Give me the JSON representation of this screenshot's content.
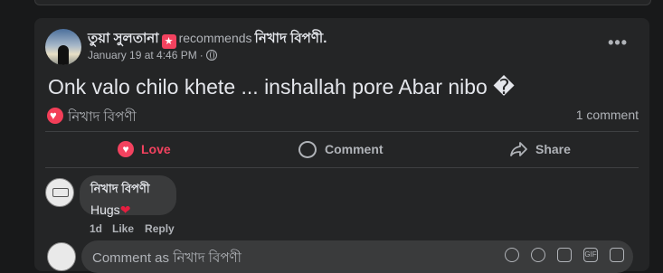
{
  "post": {
    "author": "তুয়া সুলতানা",
    "recommends_text": "recommends",
    "page_name": "নিখাদ বিপণী",
    "timestamp": "January 19 at 4:46 PM",
    "meta_separator": "·",
    "more_label": "•••",
    "text": "Onk valo chilo khete ... inshallah pore Abar nibo �",
    "reaction_name": "নিখাদ বিপণী",
    "comment_count": "1 comment"
  },
  "actions": {
    "love_label": "Love",
    "comment_label": "Comment",
    "share_label": "Share"
  },
  "comment": {
    "author": "নিখাদ বিপণী",
    "text": "Hugs",
    "time": "1d",
    "like_label": "Like",
    "reply_label": "Reply"
  },
  "reply_box": {
    "placeholder": "Comment as নিখাদ বিপণী"
  },
  "colors": {
    "background": "#18191a",
    "card": "#242526",
    "love": "#f3425f",
    "bubble": "#3a3b3c"
  },
  "icons": [
    "globe-icon",
    "more-icon",
    "love-reaction-icon",
    "heart-icon",
    "comment-icon",
    "share-icon",
    "sticker-icon",
    "emoji-icon",
    "camera-icon",
    "gif-icon",
    "sticker-smile-icon"
  ]
}
